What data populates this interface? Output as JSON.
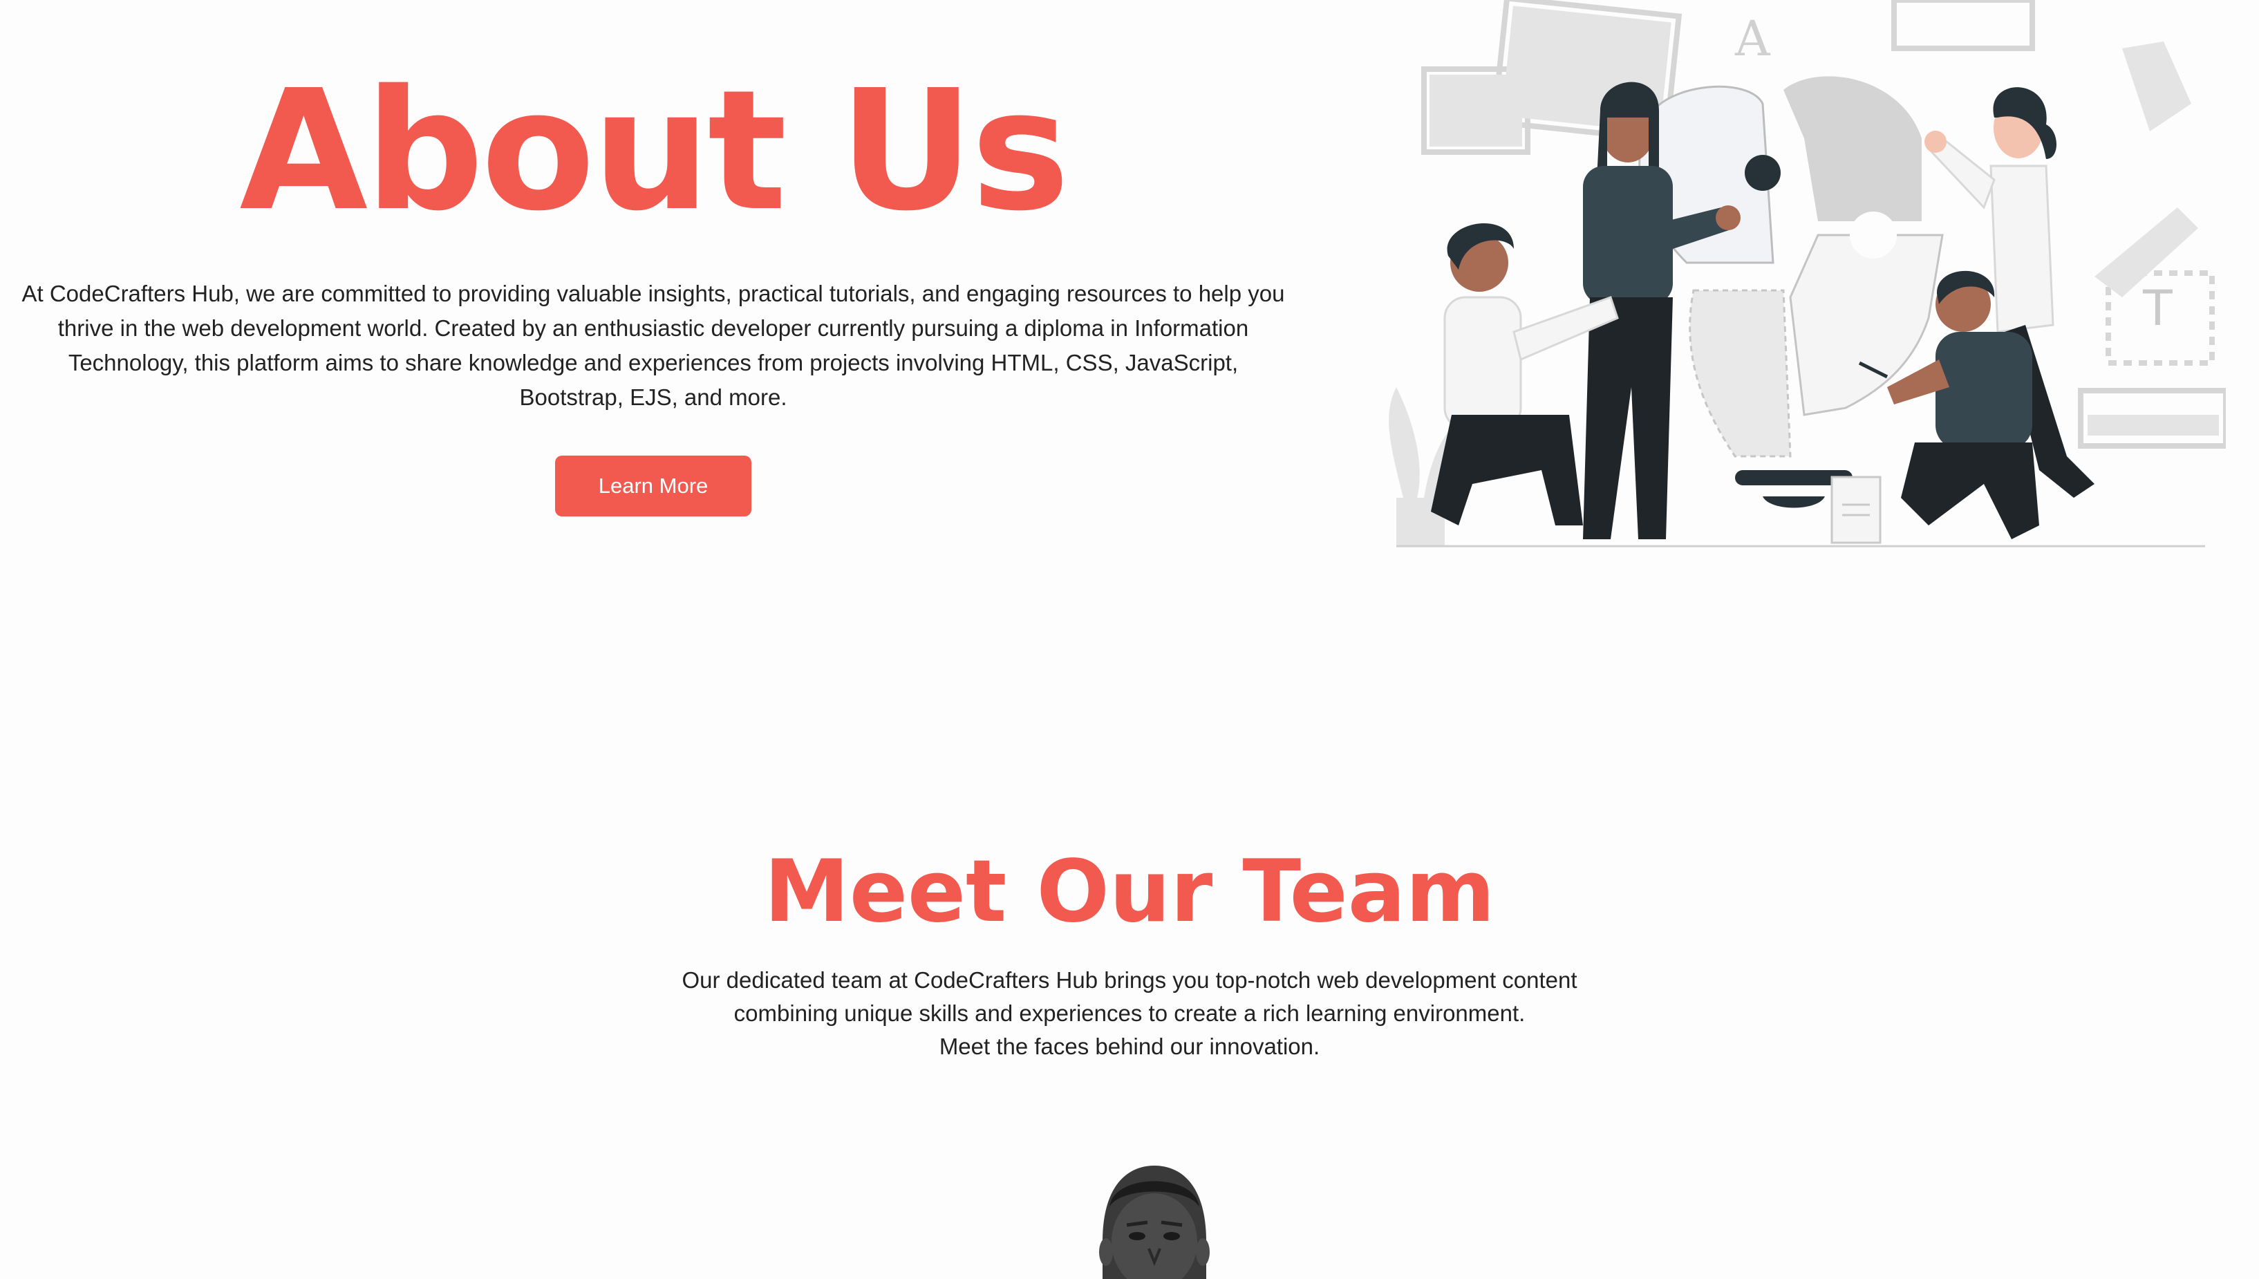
{
  "about": {
    "title": "About Us",
    "description": "At CodeCrafters Hub, we are committed to providing valuable insights, practical tutorials, and engaging resources to help you thrive in the web development world. Created by an enthusiastic developer currently pursuing a diploma in Information Technology, this platform aims to share knowledge and experiences from projects involving HTML, CSS, JavaScript, Bootstrap, EJS, and more.",
    "button_label": "Learn More",
    "illustration_icon": "team-puzzle-illustration"
  },
  "team": {
    "title": "Meet Our Team",
    "lines": [
      "Our dedicated team at CodeCrafters Hub brings you top-notch web development content",
      "combining unique skills and experiences to create a rich learning environment.",
      "Meet the faces behind our innovation."
    ],
    "member_photo_icon": "team-member-portrait"
  },
  "colors": {
    "accent": "#f25a50",
    "dark": "#263238",
    "background": "#fdfdfd"
  }
}
